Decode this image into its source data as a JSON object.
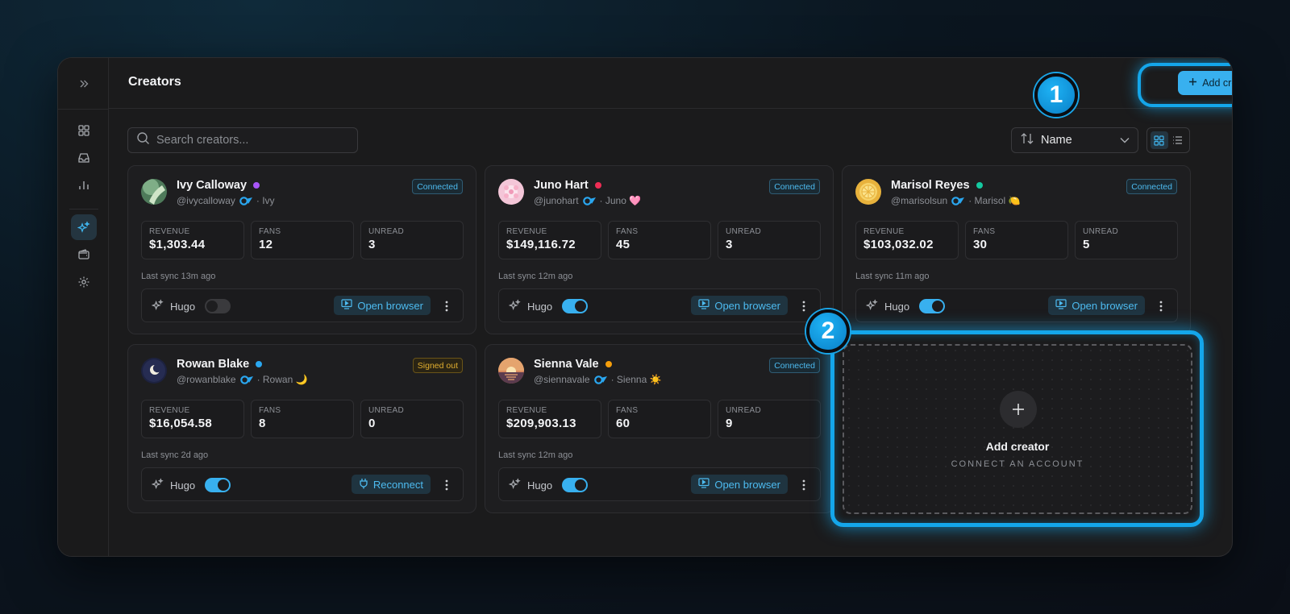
{
  "page_title": "Creators",
  "add_creator_label": "Add creator",
  "search": {
    "placeholder": "Search creators..."
  },
  "sort": {
    "label": "Name"
  },
  "steps": [
    "1",
    "2"
  ],
  "cards": [
    {
      "name": "Ivy Calloway",
      "handle": "@ivycalloway",
      "nick": "· Ivy",
      "status": "Connected",
      "dot": "#a855f7",
      "revenue_label": "REVENUE",
      "revenue": "$1,303.44",
      "fans_label": "FANS",
      "fans": "12",
      "unread_label": "UNREAD",
      "unread": "3",
      "sync": "Last sync 13m ago",
      "hugo": "Hugo",
      "hugo_on": false,
      "action": "Open browser"
    },
    {
      "name": "Juno Hart",
      "handle": "@junohart",
      "nick": "· Juno 🩷",
      "status": "Connected",
      "dot": "#ef2d55",
      "revenue_label": "REVENUE",
      "revenue": "$149,116.72",
      "fans_label": "FANS",
      "fans": "45",
      "unread_label": "UNREAD",
      "unread": "3",
      "sync": "Last sync 12m ago",
      "hugo": "Hugo",
      "hugo_on": true,
      "action": "Open browser"
    },
    {
      "name": "Marisol Reyes",
      "handle": "@marisolsun",
      "nick": "· Marisol 🍋",
      "status": "Connected",
      "dot": "#14c9a0",
      "revenue_label": "REVENUE",
      "revenue": "$103,032.02",
      "fans_label": "FANS",
      "fans": "30",
      "unread_label": "UNREAD",
      "unread": "5",
      "sync": "Last sync 11m ago",
      "hugo": "Hugo",
      "hugo_on": true,
      "action": "Open browser"
    },
    {
      "name": "Rowan Blake",
      "handle": "@rowanblake",
      "nick": "· Rowan 🌙",
      "status": "Signed out",
      "dot": "#2aa7f0",
      "revenue_label": "REVENUE",
      "revenue": "$16,054.58",
      "fans_label": "FANS",
      "fans": "8",
      "unread_label": "UNREAD",
      "unread": "0",
      "sync": "Last sync 2d ago",
      "hugo": "Hugo",
      "hugo_on": true,
      "action": "Reconnect"
    },
    {
      "name": "Sienna Vale",
      "handle": "@siennavale",
      "nick": "· Sienna ☀️",
      "status": "Connected",
      "dot": "#f59e0b",
      "revenue_label": "REVENUE",
      "revenue": "$209,903.13",
      "fans_label": "FANS",
      "fans": "60",
      "unread_label": "UNREAD",
      "unread": "9",
      "sync": "Last sync 12m ago",
      "hugo": "Hugo",
      "hugo_on": true,
      "action": "Open browser"
    }
  ],
  "add_card": {
    "title": "Add creator",
    "subtitle": "CONNECT AN ACCOUNT"
  },
  "colors": {
    "accent": "#38b0ef",
    "highlight_ring": "#14a6ea",
    "signed_out": "#e1ae2f"
  }
}
